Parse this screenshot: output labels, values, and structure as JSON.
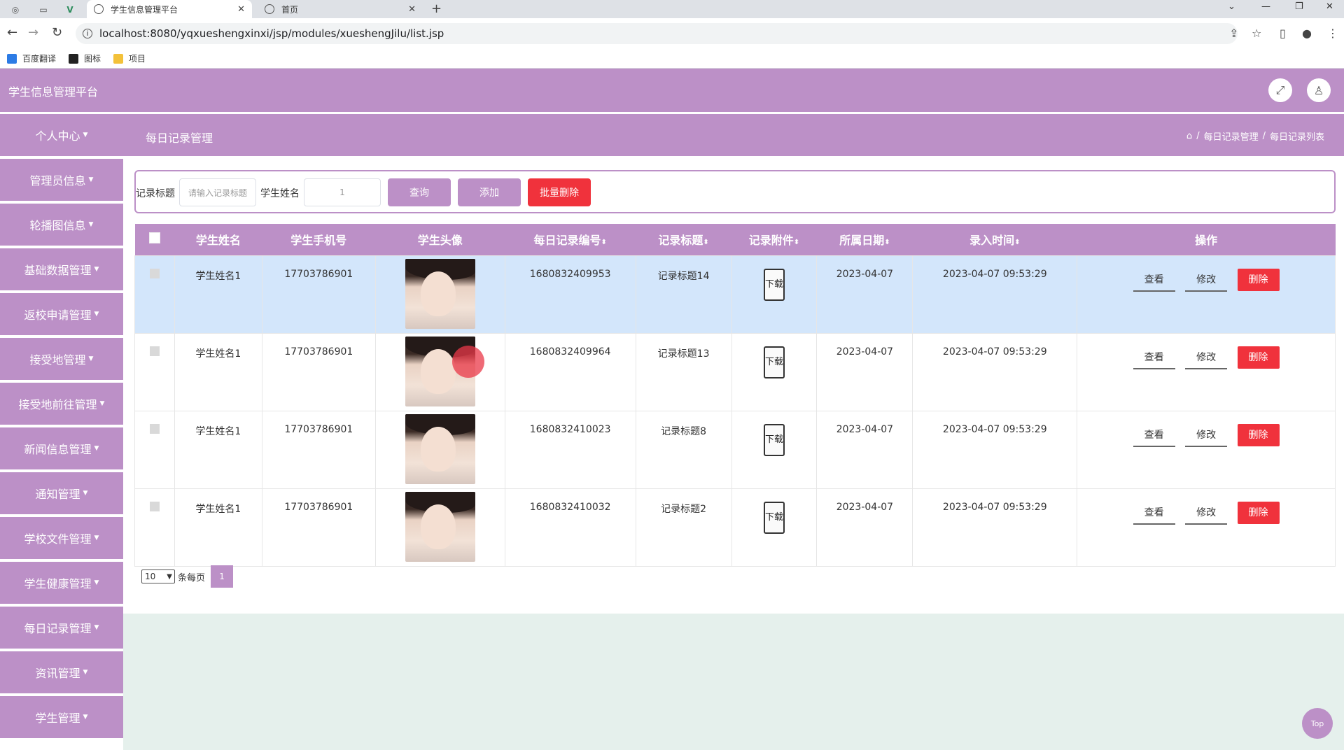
{
  "browser": {
    "tabs": [
      {
        "title": "学生信息管理平台",
        "active": true
      },
      {
        "title": "首页",
        "active": false
      }
    ],
    "url": "localhost:8080/yqxueshengxinxi/jsp/modules/xueshengJilu/list.jsp",
    "bookmarks": [
      "百度翻译",
      "图标",
      "项目"
    ]
  },
  "app": {
    "title": "学生信息管理平台",
    "accent_color": "#bc90c7",
    "danger_color": "#f0323c"
  },
  "sidebar": {
    "items": [
      {
        "label": "个人中心"
      },
      {
        "label": "管理员信息"
      },
      {
        "label": "轮播图信息"
      },
      {
        "label": "基础数据管理"
      },
      {
        "label": "返校申请管理"
      },
      {
        "label": "接受地管理"
      },
      {
        "label": "接受地前往管理"
      },
      {
        "label": "新闻信息管理"
      },
      {
        "label": "通知管理"
      },
      {
        "label": "学校文件管理"
      },
      {
        "label": "学生健康管理"
      },
      {
        "label": "每日记录管理"
      },
      {
        "label": "资讯管理"
      },
      {
        "label": "学生管理"
      }
    ]
  },
  "page": {
    "title": "每日记录管理",
    "breadcrumb": [
      "每日记录管理",
      "每日记录列表"
    ]
  },
  "search": {
    "title_label": "记录标题",
    "title_placeholder": "请输入记录标题",
    "name_label": "学生姓名",
    "name_value": "1",
    "query_label": "查询",
    "add_label": "添加",
    "batch_delete_label": "批量删除"
  },
  "table": {
    "headers": [
      "学生姓名",
      "学生手机号",
      "学生头像",
      "每日记录编号",
      "记录标题",
      "记录附件",
      "所属日期",
      "录入时间",
      "操作"
    ],
    "download_label": "下载",
    "view_label": "查看",
    "edit_label": "修改",
    "delete_label": "删除",
    "rows": [
      {
        "name": "学生姓名1",
        "phone": "17703786901",
        "code": "1680832409953",
        "title": "记录标题14",
        "date": "2023-04-07",
        "time": "2023-04-07 09:53:29"
      },
      {
        "name": "学生姓名1",
        "phone": "17703786901",
        "code": "1680832409964",
        "title": "记录标题13",
        "date": "2023-04-07",
        "time": "2023-04-07 09:53:29"
      },
      {
        "name": "学生姓名1",
        "phone": "17703786901",
        "code": "1680832410023",
        "title": "记录标题8",
        "date": "2023-04-07",
        "time": "2023-04-07 09:53:29"
      },
      {
        "name": "学生姓名1",
        "phone": "17703786901",
        "code": "1680832410032",
        "title": "记录标题2",
        "date": "2023-04-07",
        "time": "2023-04-07 09:53:29"
      }
    ]
  },
  "pagination": {
    "page_size": "10",
    "per_page_label": "条每页",
    "current_page": "1"
  },
  "back_to_top_label": "Top"
}
